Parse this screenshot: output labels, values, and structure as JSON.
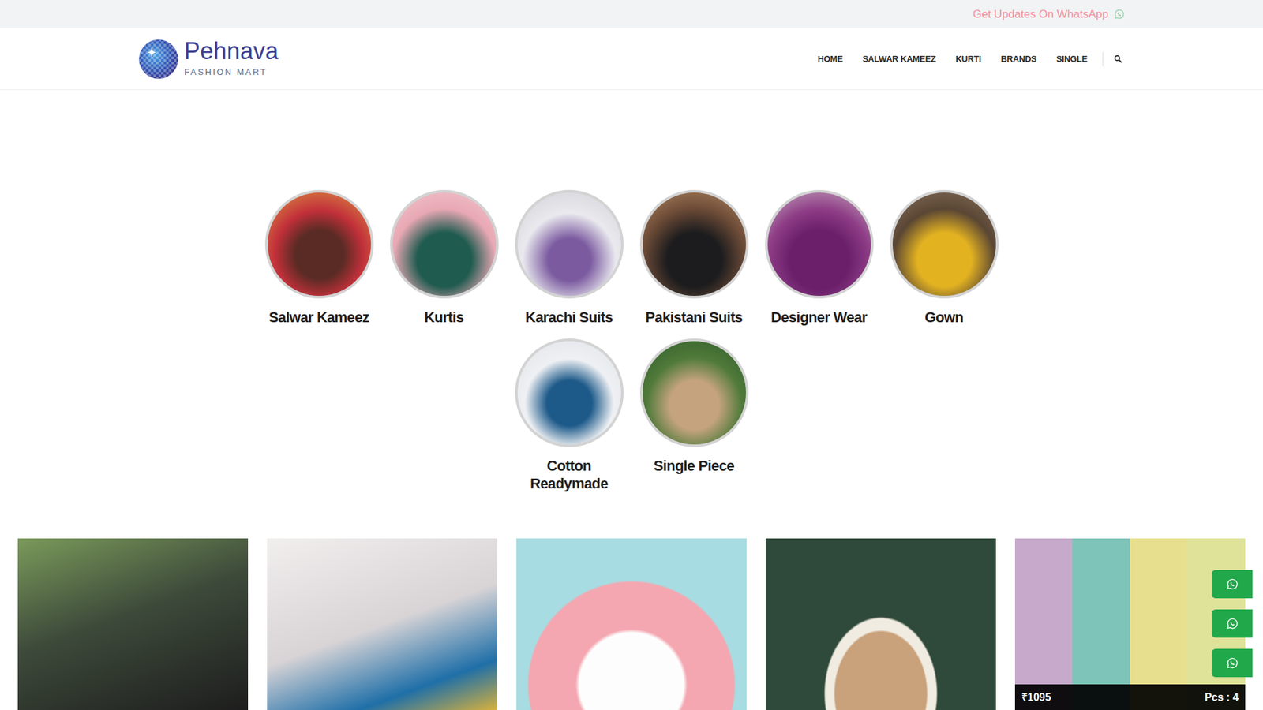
{
  "topbar": {
    "text": "Get Updates On WhatsApp"
  },
  "logo": {
    "name": "Pehnava",
    "tagline": "FASHION MART"
  },
  "nav": [
    {
      "label": "HOME"
    },
    {
      "label": "SALWAR KAMEEZ"
    },
    {
      "label": "KURTI"
    },
    {
      "label": "BRANDS"
    },
    {
      "label": "SINGLE"
    }
  ],
  "categories": [
    {
      "label": "Salwar Kameez"
    },
    {
      "label": "Kurtis"
    },
    {
      "label": "Karachi Suits"
    },
    {
      "label": "Pakistani Suits"
    },
    {
      "label": "Designer Wear"
    },
    {
      "label": "Gown"
    },
    {
      "label": "Cotton Readymade"
    },
    {
      "label": "Single Piece"
    }
  ],
  "products": [
    {
      "kind": "image"
    },
    {
      "kind": "image"
    },
    {
      "kind": "image"
    },
    {
      "kind": "image"
    },
    {
      "kind": "priced",
      "price": "₹1095",
      "pcs": "Pcs : 4"
    }
  ],
  "floating_buttons": [
    {
      "kind": "whatsapp"
    },
    {
      "kind": "whatsapp"
    },
    {
      "kind": "whatsapp"
    }
  ]
}
